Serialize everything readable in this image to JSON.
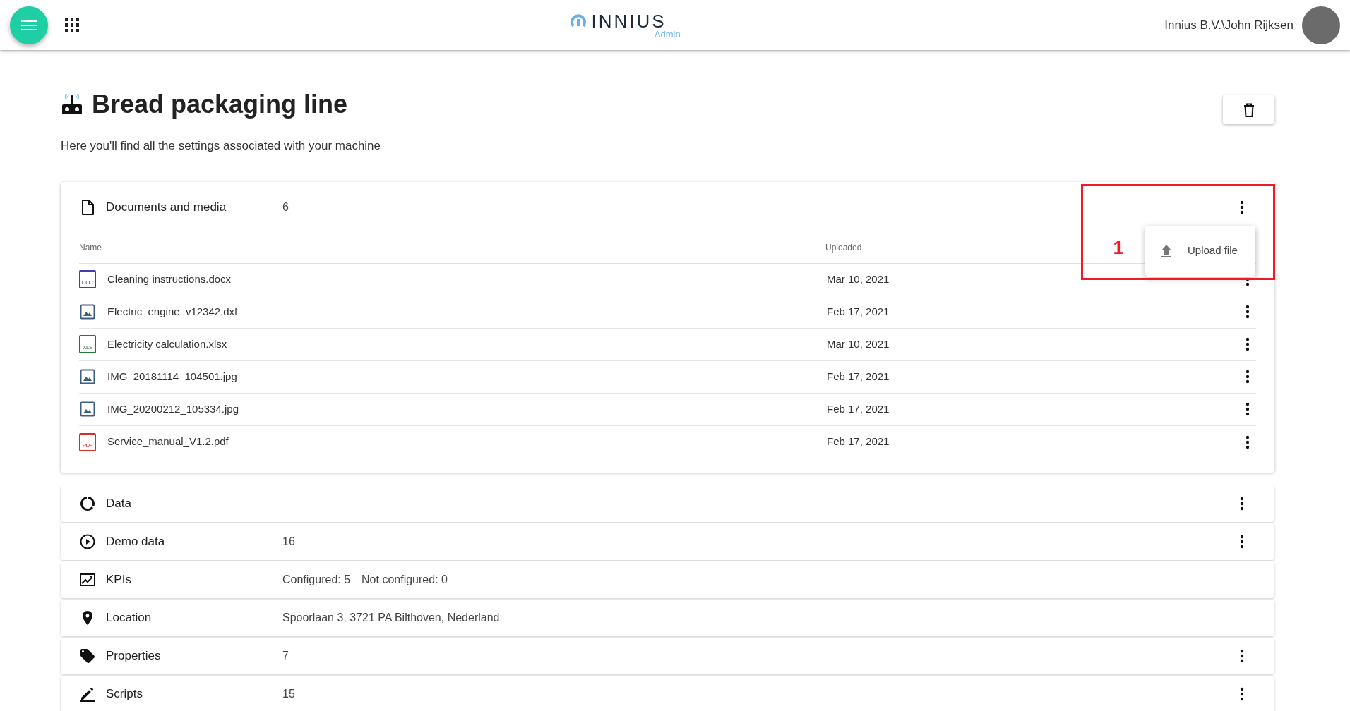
{
  "header": {
    "logo_text": "INNIUS",
    "logo_sub": "Admin",
    "user": "Innius B.V.\\John Rijksen"
  },
  "page": {
    "title": "Bread packaging line",
    "subtitle": "Here you'll find all the settings associated with your machine"
  },
  "documents": {
    "title": "Documents and media",
    "count": "6",
    "columns": [
      "Name",
      "Uploaded"
    ],
    "rows": [
      {
        "kind": "doc",
        "name": "Cleaning instructions.docx",
        "uploaded": "Mar 10, 2021",
        "badge": "DOC"
      },
      {
        "kind": "image",
        "name": "Electric_engine_v12342.dxf",
        "uploaded": "Feb 17, 2021"
      },
      {
        "kind": "sheet",
        "name": "Electricity calculation.xlsx",
        "uploaded": "Mar 10, 2021",
        "badge": "XLS"
      },
      {
        "kind": "image",
        "name": "IMG_20181114_104501.jpg",
        "uploaded": "Feb 17, 2021"
      },
      {
        "kind": "image",
        "name": "IMG_20200212_105334.jpg",
        "uploaded": "Feb 17, 2021"
      },
      {
        "kind": "pdf",
        "name": "Service_manual_V1.2.pdf",
        "uploaded": "Feb 17, 2021",
        "badge": "PDF"
      }
    ],
    "menu": {
      "items": [
        "Upload file"
      ]
    }
  },
  "annotation": {
    "label": "1"
  },
  "sections": [
    {
      "kind": "data",
      "title": "Data",
      "menu": true
    },
    {
      "kind": "demo",
      "title": "Demo data",
      "value": "16",
      "menu": true
    },
    {
      "kind": "kpi",
      "title": "KPIs",
      "values": [
        "Configured: 5",
        "Not configured: 0"
      ],
      "menu": false
    },
    {
      "kind": "location",
      "title": "Location",
      "value": "Spoorlaan 3, 3721 PA Bilthoven, Nederland",
      "menu": false
    },
    {
      "kind": "properties",
      "title": "Properties",
      "value": "7",
      "menu": true
    },
    {
      "kind": "scripts",
      "title": "Scripts",
      "value": "15",
      "menu": true
    }
  ]
}
